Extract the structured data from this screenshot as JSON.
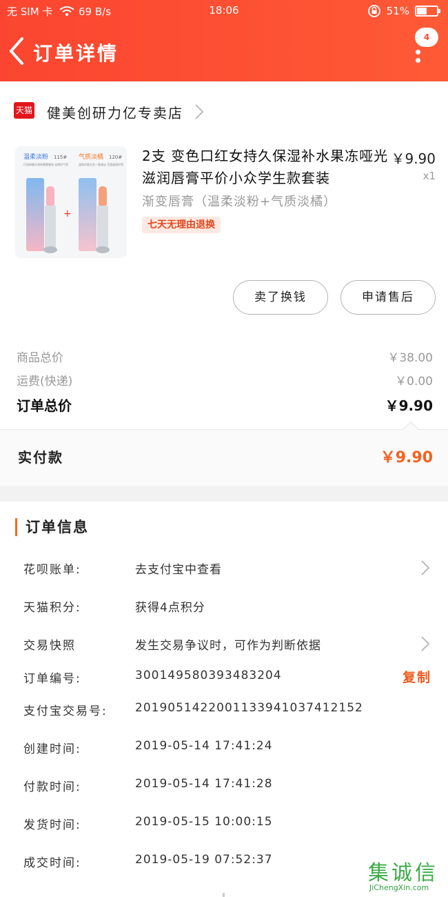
{
  "status_bar": {
    "carrier": "无 SIM 卡",
    "speed": "69 B/s",
    "time": "18:06",
    "battery": "51%",
    "battery_level": 0.51
  },
  "header": {
    "title": "订单详情",
    "badge": "4",
    "back_icon": "chevron-left-icon",
    "more_icon": "more-vertical-icon"
  },
  "shop": {
    "logo_text": "天猫",
    "name": "健美创研力亿专卖店"
  },
  "product": {
    "image_labels": {
      "left_name": "温柔淡粉",
      "left_code": "115#",
      "left_desc": "打造粉嫩水润的蜜唇感觉 自然好气色",
      "right_name": "气质淡橘",
      "right_code": "120#",
      "right_desc": "温和内敛文艺一款清淡 百搭滋润好色",
      "plus": "+"
    },
    "title": "2支 变色口红女持久保湿补水果冻哑光滋润唇膏平价小众学生款套装",
    "price": "￥9.90",
    "quantity": "x1",
    "sku": "渐变唇膏（温柔淡粉+气质淡橘）",
    "tag": "七天无理由退换"
  },
  "actions": {
    "buy_again": "卖了换钱",
    "after_sale": "申请售后"
  },
  "pricing": {
    "goods_total_label": "商品总价",
    "goods_total": "￥38.00",
    "shipping_label": "运费(快递)",
    "shipping": "￥0.00",
    "order_total_label": "订单总价",
    "order_total": "￥9.90",
    "paid_label": "实付款",
    "paid": "￥9.90"
  },
  "order_info": {
    "title": "订单信息",
    "rows": [
      {
        "key": "花呗账单:",
        "value": "去支付宝中查看"
      },
      {
        "key": "天猫积分:",
        "value": "获得4点积分"
      },
      {
        "key": "交易快照",
        "value": "发生交易争议时，可作为判断依据"
      },
      {
        "key": "订单编号:",
        "value": "300149580393483204",
        "action": "复制"
      },
      {
        "key": "支付宝交易号:",
        "value": "2019051422001133941037412152"
      },
      {
        "key": "创建时间:",
        "value": "2019-05-14 17:41:24"
      },
      {
        "key": "付款时间:",
        "value": "2019-05-14 17:41:28"
      },
      {
        "key": "发货时间:",
        "value": "2019-05-15 10:00:15"
      },
      {
        "key": "成交时间:",
        "value": "2019-05-19 07:52:37"
      }
    ]
  },
  "watermark": {
    "text": "集诚信",
    "url": "JiChengXin.com"
  },
  "colors": {
    "header": "#fb4530",
    "accent": "#f4621e",
    "tag_bg": "#fde9e2"
  }
}
